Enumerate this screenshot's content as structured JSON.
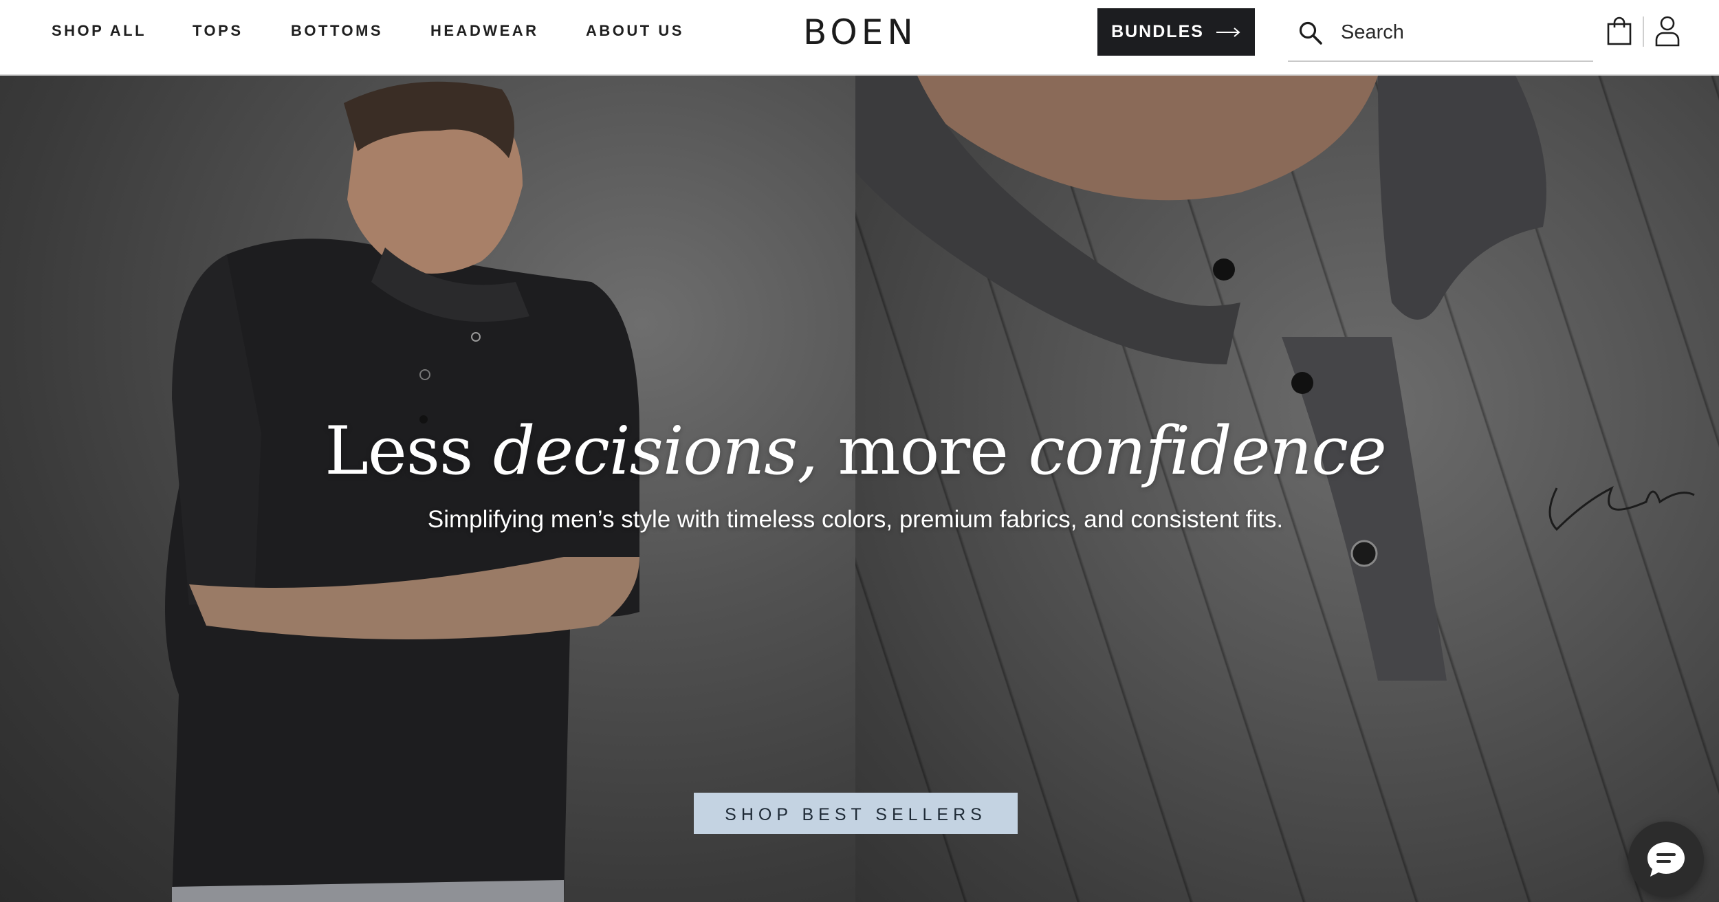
{
  "header": {
    "nav": [
      {
        "label": "SHOP ALL"
      },
      {
        "label": "TOPS"
      },
      {
        "label": "BOTTOMS"
      },
      {
        "label": "HEADWEAR"
      },
      {
        "label": "ABOUT US"
      }
    ],
    "logo": "BOEN",
    "bundles_label": "BUNDLES",
    "search_placeholder": "Search",
    "icons": {
      "search": "search-icon",
      "cart": "shopping-bag-icon",
      "account": "user-icon",
      "bundles_arrow": "arrow-right-icon"
    }
  },
  "hero": {
    "headline": {
      "part1": "Less ",
      "part2_italic": "decisions,",
      "part3": " more ",
      "part4_italic": "confidence"
    },
    "subheadline": "Simplifying men’s style with timeless colors, premium fabrics, and consistent fits.",
    "cta_label": "SHOP BEST SELLERS"
  },
  "chat": {
    "icon": "chat-bubble-icon"
  },
  "colors": {
    "header_bg": "#ffffff",
    "bundles_bg": "#1c1d20",
    "cta_bg": "#c4d3e2",
    "chat_bg": "#2c2c2c"
  }
}
